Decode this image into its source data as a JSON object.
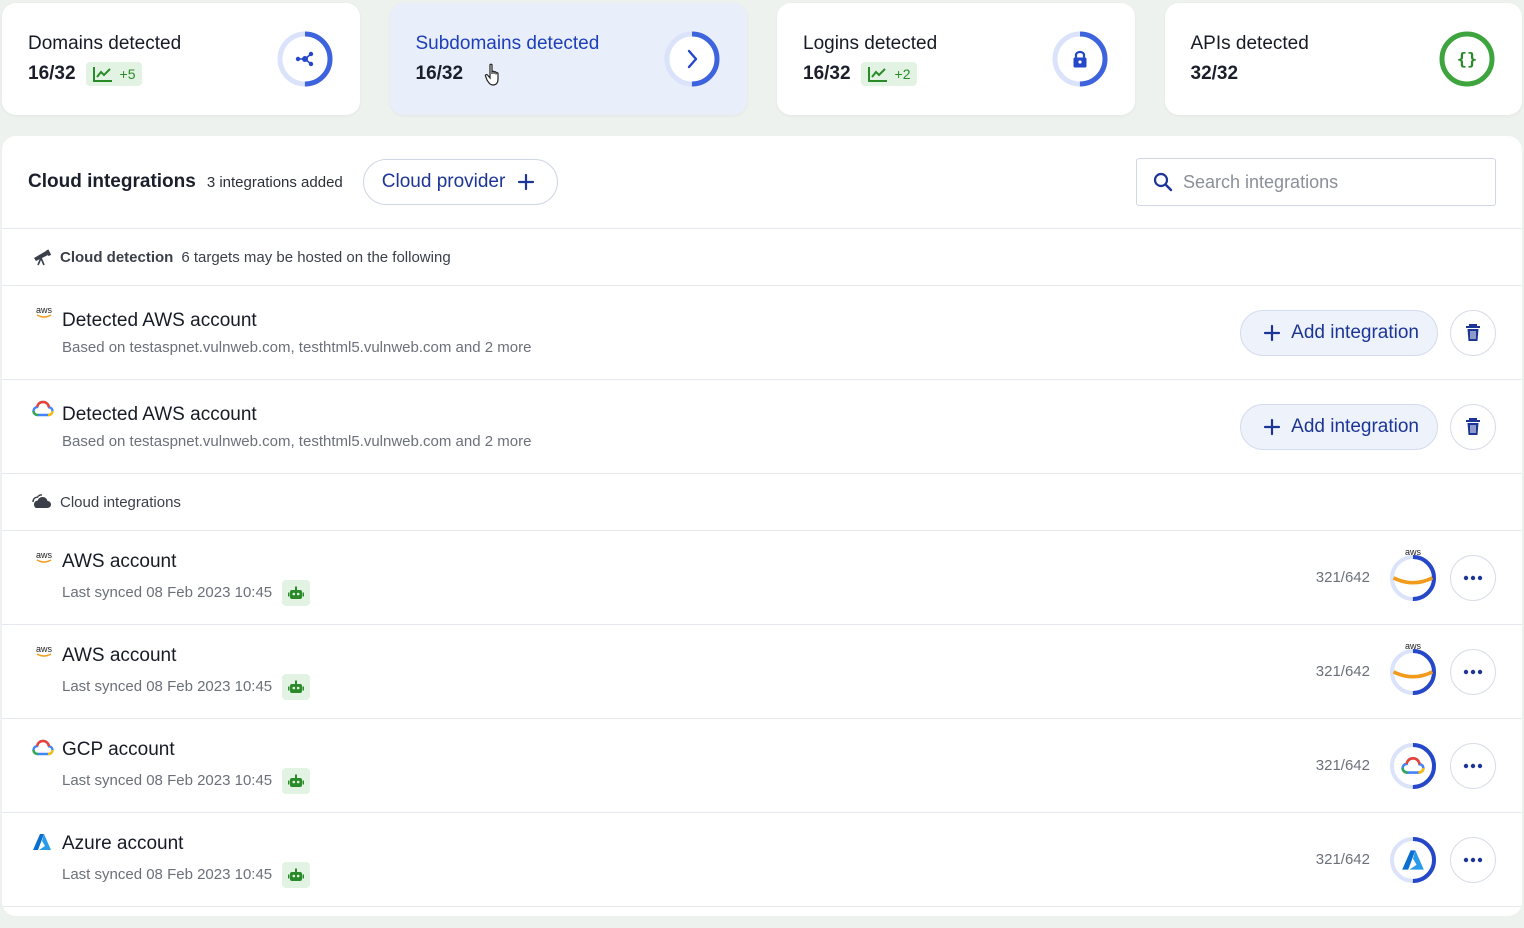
{
  "cards": [
    {
      "title": "Domains detected",
      "value": "16/32",
      "trend": "+5",
      "icon": "network-icon",
      "progress": 0.5,
      "active": false
    },
    {
      "title": "Subdomains detected",
      "value": "16/32",
      "icon": "chevron-right-icon",
      "progress": 0.5,
      "active": true
    },
    {
      "title": "Logins detected",
      "value": "16/32",
      "trend": "+2",
      "icon": "lock-icon",
      "progress": 0.5,
      "active": false
    },
    {
      "title": "APIs detected",
      "value": "32/32",
      "icon": "braces-icon",
      "progress": 1.0,
      "active": false
    }
  ],
  "panel": {
    "title": "Cloud integrations",
    "count": "3 integrations added",
    "provider_button": "Cloud provider",
    "search_placeholder": "Search integrations"
  },
  "detection": {
    "label": "Cloud detection",
    "text": "6 targets may be hosted on the following",
    "icon": "telescope-icon",
    "items": [
      {
        "logo": "aws-logo-icon",
        "title": "Detected AWS account",
        "sub": "Based on testaspnet.vulnweb.com, testhtml5.vulnweb.com and 2 more",
        "button": "Add integration"
      },
      {
        "logo": "gcp-logo-icon",
        "title": "Detected AWS account",
        "sub": "Based on testaspnet.vulnweb.com, testhtml5.vulnweb.com and 2 more",
        "button": "Add integration"
      }
    ]
  },
  "integrations": {
    "label": "Cloud integrations",
    "icon": "clouds-icon",
    "items": [
      {
        "logo": "aws-logo-icon",
        "title": "AWS account",
        "synced": "Last synced 08 Feb 2023 10:45",
        "ratio": "321/642",
        "progress": 0.5
      },
      {
        "logo": "aws-logo-icon",
        "title": "AWS account",
        "synced": "Last synced 08 Feb 2023 10:45",
        "ratio": "321/642",
        "progress": 0.5
      },
      {
        "logo": "gcp-logo-icon",
        "title": "GCP account",
        "synced": "Last synced 08 Feb 2023 10:45",
        "ratio": "321/642",
        "progress": 0.5
      },
      {
        "logo": "azure-logo-icon",
        "title": "Azure account",
        "synced": "Last synced 08 Feb 2023 10:45",
        "ratio": "321/642",
        "progress": 0.5
      }
    ]
  },
  "aws_label": "aws",
  "colors": {
    "accent": "#1d3fb8",
    "ring_track": "#dbe3fb",
    "success": "#2a9a2a"
  }
}
